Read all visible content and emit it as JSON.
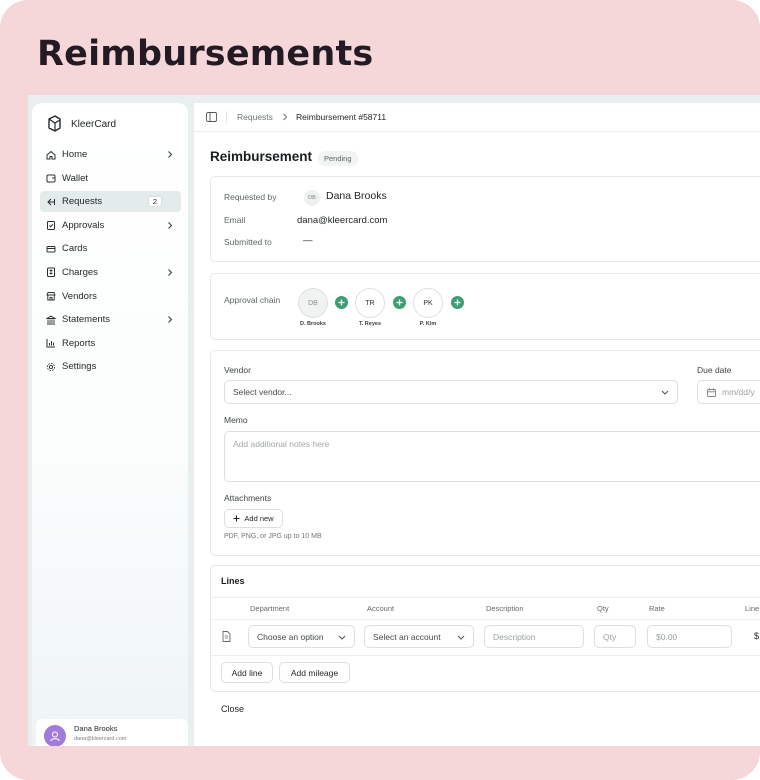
{
  "frame": {
    "title": "Reimbursements"
  },
  "brand": {
    "name": "KleerCard"
  },
  "sidebar": {
    "items": [
      {
        "label": "Home",
        "icon": "home-icon",
        "chevron": true
      },
      {
        "label": "Wallet",
        "icon": "wallet-icon",
        "chevron": false
      },
      {
        "label": "Requests",
        "icon": "requests-icon",
        "chevron": false,
        "badge": "2",
        "active": true
      },
      {
        "label": "Approvals",
        "icon": "clipboard-check-icon",
        "chevron": true
      },
      {
        "label": "Cards",
        "icon": "card-icon",
        "chevron": false
      },
      {
        "label": "Charges",
        "icon": "receipt-icon",
        "chevron": true
      },
      {
        "label": "Vendors",
        "icon": "store-icon",
        "chevron": false
      },
      {
        "label": "Statements",
        "icon": "bank-icon",
        "chevron": true
      },
      {
        "label": "Reports",
        "icon": "chart-icon",
        "chevron": false
      },
      {
        "label": "Settings",
        "icon": "gear-icon",
        "chevron": false
      }
    ]
  },
  "user": {
    "name": "Dana Brooks",
    "email": "dana@kleercard.com"
  },
  "breadcrumb": {
    "parent": "Requests",
    "current": "Reimbursement #58711"
  },
  "page": {
    "title": "Reimbursement",
    "status": "Pending"
  },
  "info": {
    "requested_by_label": "Requested by",
    "requested_by_initials": "DB",
    "requested_by_name": "Dana Brooks",
    "email_label": "Email",
    "email_value": "dana@kleercard.com",
    "submitted_to_label": "Submitted to",
    "submitted_to_value": "—"
  },
  "approval_chain": {
    "label": "Approval chain",
    "approvers": [
      {
        "initials": "DB",
        "caption": "D. Brooks"
      },
      {
        "initials": "TR",
        "caption": "T. Reyes"
      },
      {
        "initials": "PK",
        "caption": "P. Kim"
      }
    ]
  },
  "form": {
    "vendor_label": "Vendor",
    "vendor_placeholder": "Select vendor...",
    "due_date_label": "Due date",
    "due_date_placeholder": "mm/dd/y",
    "memo_label": "Memo",
    "memo_placeholder": "Add additional notes here",
    "attachments_label": "Attachments",
    "add_new_label": "Add new",
    "attachments_hint": "PDF, PNG, or JPG up to 10 MB"
  },
  "lines": {
    "title": "Lines",
    "columns": [
      "Department",
      "Account",
      "Description",
      "Qty",
      "Rate",
      "Line"
    ],
    "row": {
      "department": "Choose an option",
      "account": "Select an account",
      "description_placeholder": "Description",
      "qty_placeholder": "Qty",
      "rate_placeholder": "$0.00",
      "line_total": "$"
    },
    "add_line_label": "Add line",
    "add_mileage_label": "Add mileage"
  },
  "footer": {
    "close_label": "Close"
  },
  "colors": {
    "accent_green": "#3d9e73",
    "frame_pink": "#f5d7da",
    "avatar_purple": "#a27ad9"
  }
}
